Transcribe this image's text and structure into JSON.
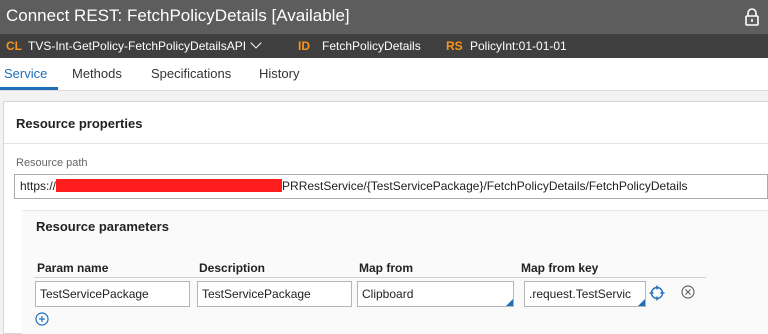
{
  "window": {
    "title": "Connect REST: FetchPolicyDetails [Available]",
    "lock_icon": "lock-icon"
  },
  "identity": {
    "cl_key": "CL",
    "cl_value": "TVS-Int-GetPolicy-FetchPolicyDetailsAPI",
    "id_key": "ID",
    "id_value": "FetchPolicyDetails",
    "rs_key": "RS",
    "rs_value": "PolicyInt:01-01-01"
  },
  "tabs": [
    {
      "label": "Service",
      "active": true
    },
    {
      "label": "Methods",
      "active": false
    },
    {
      "label": "Specifications",
      "active": false
    },
    {
      "label": "History",
      "active": false
    }
  ],
  "resource": {
    "section_title": "Resource properties",
    "path_label": "Resource path",
    "path_prefix": "https://",
    "path_suffix": "PRRestService/{TestServicePackage}/FetchPolicyDetails/FetchPolicyDetails"
  },
  "params": {
    "title": "Resource parameters",
    "columns": [
      "Param name",
      "Description",
      "Map from",
      "Map from key"
    ],
    "rows": [
      {
        "param_name": "TestServicePackage",
        "description": "TestServicePackage",
        "map_from": "Clipboard",
        "map_from_key": ".request.TestServic"
      }
    ]
  },
  "colors": {
    "accent": "#1f6fb8",
    "key_orange": "#f7941d",
    "titlebar": "#5d5d5d",
    "idbar": "#3f3f3f",
    "redaction": "#ff1d1d"
  }
}
